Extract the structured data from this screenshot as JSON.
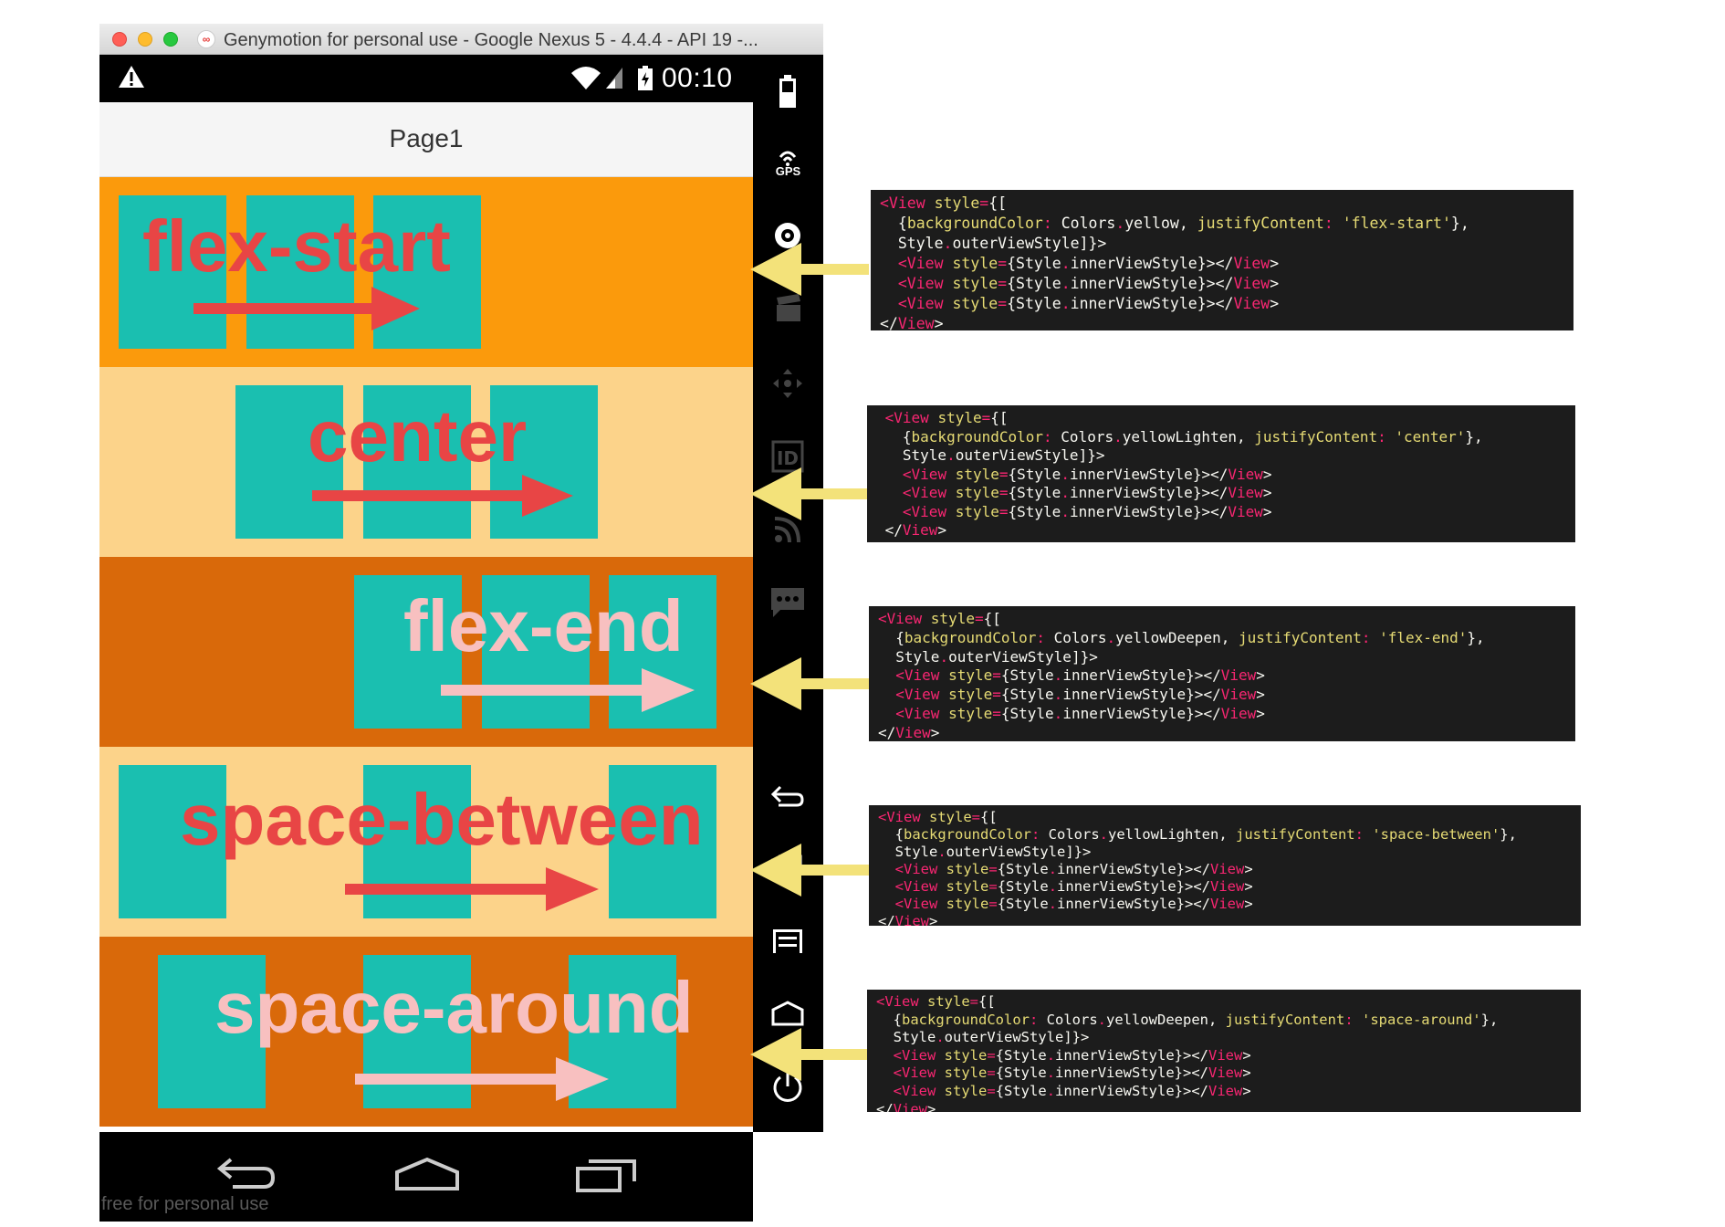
{
  "window": {
    "title": "Genymotion for personal use - Google Nexus 5 - 4.4.4 - API 19 -..."
  },
  "status_bar": {
    "time": "00:10",
    "icons": [
      "warning-icon",
      "wifi-icon",
      "signal-icon",
      "battery-icon"
    ]
  },
  "app_bar": {
    "title": "Page1"
  },
  "rows": [
    {
      "label": "flex-start",
      "bg": "#fb9a0c",
      "label_color": "#e84545"
    },
    {
      "label": "center",
      "bg": "#fcd38a",
      "label_color": "#e84545"
    },
    {
      "label": "flex-end",
      "bg": "#d9690a",
      "label_color": "#f8c0c0"
    },
    {
      "label": "space-between",
      "bg": "#fcd38a",
      "label_color": "#e84545"
    },
    {
      "label": "space-around",
      "bg": "#d9690a",
      "label_color": "#f8c0c0"
    }
  ],
  "colors": {
    "tile": "#1abfb0",
    "pointer_arrow": "#f3e27a",
    "code_bg": "#1c1c1c"
  },
  "toolbar": {
    "gps_label": "GPS",
    "icons": [
      "battery-icon",
      "gps-icon",
      "camera-icon",
      "video-icon",
      "dpad-icon",
      "id-icon",
      "rss-icon",
      "sms-icon",
      "back-icon",
      "recent-apps-icon",
      "menu-icon",
      "home-icon",
      "power-icon",
      "more-icon"
    ]
  },
  "nav_bar": {
    "icons": [
      "back-icon",
      "home-icon",
      "recent-apps-icon"
    ],
    "watermark": "free for personal use"
  },
  "code_snippets": [
    {
      "lines": [
        [
          [
            "t",
            "<View "
          ],
          [
            "a",
            "style"
          ],
          [
            "t",
            "="
          ],
          [
            "p",
            "{["
          ]
        ],
        [
          [
            "p",
            "  {"
          ],
          [
            "a",
            "backgroundColor"
          ],
          [
            "t",
            ": "
          ],
          [
            "p",
            "Colors"
          ],
          [
            "t",
            "."
          ],
          [
            "p",
            "yellow, "
          ],
          [
            "a",
            "justifyContent"
          ],
          [
            "t",
            ": "
          ],
          [
            "s",
            "'flex-start'"
          ],
          [
            "p",
            "},"
          ]
        ],
        [
          [
            "p",
            "  Style"
          ],
          [
            "t",
            "."
          ],
          [
            "p",
            "outerViewStyle]}>"
          ]
        ],
        [
          [
            "p",
            "  "
          ],
          [
            "t",
            "<View "
          ],
          [
            "a",
            "style"
          ],
          [
            "t",
            "="
          ],
          [
            "p",
            "{Style"
          ],
          [
            "t",
            "."
          ],
          [
            "p",
            "innerViewStyle}></"
          ],
          [
            "t",
            "View"
          ],
          [
            "p",
            ">"
          ]
        ],
        [
          [
            "p",
            "  "
          ],
          [
            "t",
            "<View "
          ],
          [
            "a",
            "style"
          ],
          [
            "t",
            "="
          ],
          [
            "p",
            "{Style"
          ],
          [
            "t",
            "."
          ],
          [
            "p",
            "innerViewStyle}></"
          ],
          [
            "t",
            "View"
          ],
          [
            "p",
            ">"
          ]
        ],
        [
          [
            "p",
            "  "
          ],
          [
            "t",
            "<View "
          ],
          [
            "a",
            "style"
          ],
          [
            "t",
            "="
          ],
          [
            "p",
            "{Style"
          ],
          [
            "t",
            "."
          ],
          [
            "p",
            "innerViewStyle}></"
          ],
          [
            "t",
            "View"
          ],
          [
            "p",
            ">"
          ]
        ],
        [
          [
            "p",
            "</"
          ],
          [
            "t",
            "View"
          ],
          [
            "p",
            ">"
          ]
        ]
      ]
    },
    {
      "lines": [
        [
          [
            "p",
            " "
          ],
          [
            "t",
            "<View "
          ],
          [
            "a",
            "style"
          ],
          [
            "t",
            "="
          ],
          [
            "p",
            "{["
          ]
        ],
        [
          [
            "p",
            "   {"
          ],
          [
            "a",
            "backgroundColor"
          ],
          [
            "t",
            ": "
          ],
          [
            "p",
            "Colors"
          ],
          [
            "t",
            "."
          ],
          [
            "p",
            "yellowLighten, "
          ],
          [
            "a",
            "justifyContent"
          ],
          [
            "t",
            ": "
          ],
          [
            "s",
            "'center'"
          ],
          [
            "p",
            "},"
          ]
        ],
        [
          [
            "p",
            "   Style"
          ],
          [
            "t",
            "."
          ],
          [
            "p",
            "outerViewStyle]}>"
          ]
        ],
        [
          [
            "p",
            "   "
          ],
          [
            "t",
            "<View "
          ],
          [
            "a",
            "style"
          ],
          [
            "t",
            "="
          ],
          [
            "p",
            "{Style"
          ],
          [
            "t",
            "."
          ],
          [
            "p",
            "innerViewStyle}></"
          ],
          [
            "t",
            "View"
          ],
          [
            "p",
            ">"
          ]
        ],
        [
          [
            "p",
            "   "
          ],
          [
            "t",
            "<View "
          ],
          [
            "a",
            "style"
          ],
          [
            "t",
            "="
          ],
          [
            "p",
            "{Style"
          ],
          [
            "t",
            "."
          ],
          [
            "p",
            "innerViewStyle}></"
          ],
          [
            "t",
            "View"
          ],
          [
            "p",
            ">"
          ]
        ],
        [
          [
            "p",
            "   "
          ],
          [
            "t",
            "<View "
          ],
          [
            "a",
            "style"
          ],
          [
            "t",
            "="
          ],
          [
            "p",
            "{Style"
          ],
          [
            "t",
            "."
          ],
          [
            "p",
            "innerViewStyle}></"
          ],
          [
            "t",
            "View"
          ],
          [
            "p",
            ">"
          ]
        ],
        [
          [
            "p",
            " </"
          ],
          [
            "t",
            "View"
          ],
          [
            "p",
            ">"
          ]
        ]
      ]
    },
    {
      "lines": [
        [
          [
            "t",
            "<View "
          ],
          [
            "a",
            "style"
          ],
          [
            "t",
            "="
          ],
          [
            "p",
            "{["
          ]
        ],
        [
          [
            "p",
            "  {"
          ],
          [
            "a",
            "backgroundColor"
          ],
          [
            "t",
            ": "
          ],
          [
            "p",
            "Colors"
          ],
          [
            "t",
            "."
          ],
          [
            "p",
            "yellowDeepen, "
          ],
          [
            "a",
            "justifyContent"
          ],
          [
            "t",
            ": "
          ],
          [
            "s",
            "'flex-end'"
          ],
          [
            "p",
            "},"
          ]
        ],
        [
          [
            "p",
            "  Style"
          ],
          [
            "t",
            "."
          ],
          [
            "p",
            "outerViewStyle]}>"
          ]
        ],
        [
          [
            "p",
            "  "
          ],
          [
            "t",
            "<View "
          ],
          [
            "a",
            "style"
          ],
          [
            "t",
            "="
          ],
          [
            "p",
            "{Style"
          ],
          [
            "t",
            "."
          ],
          [
            "p",
            "innerViewStyle}></"
          ],
          [
            "t",
            "View"
          ],
          [
            "p",
            ">"
          ]
        ],
        [
          [
            "p",
            "  "
          ],
          [
            "t",
            "<View "
          ],
          [
            "a",
            "style"
          ],
          [
            "t",
            "="
          ],
          [
            "p",
            "{Style"
          ],
          [
            "t",
            "."
          ],
          [
            "p",
            "innerViewStyle}></"
          ],
          [
            "t",
            "View"
          ],
          [
            "p",
            ">"
          ]
        ],
        [
          [
            "p",
            "  "
          ],
          [
            "t",
            "<View "
          ],
          [
            "a",
            "style"
          ],
          [
            "t",
            "="
          ],
          [
            "p",
            "{Style"
          ],
          [
            "t",
            "."
          ],
          [
            "p",
            "innerViewStyle}></"
          ],
          [
            "t",
            "View"
          ],
          [
            "p",
            ">"
          ]
        ],
        [
          [
            "p",
            "</"
          ],
          [
            "t",
            "View"
          ],
          [
            "p",
            ">"
          ]
        ]
      ]
    },
    {
      "lines": [
        [
          [
            "t",
            "<View "
          ],
          [
            "a",
            "style"
          ],
          [
            "t",
            "="
          ],
          [
            "p",
            "{["
          ]
        ],
        [
          [
            "p",
            "  {"
          ],
          [
            "a",
            "backgroundColor"
          ],
          [
            "t",
            ": "
          ],
          [
            "p",
            "Colors"
          ],
          [
            "t",
            "."
          ],
          [
            "p",
            "yellowLighten, "
          ],
          [
            "a",
            "justifyContent"
          ],
          [
            "t",
            ": "
          ],
          [
            "s",
            "'space-between'"
          ],
          [
            "p",
            "},"
          ]
        ],
        [
          [
            "p",
            "  Style"
          ],
          [
            "t",
            "."
          ],
          [
            "p",
            "outerViewStyle]}>"
          ]
        ],
        [
          [
            "p",
            "  "
          ],
          [
            "t",
            "<View "
          ],
          [
            "a",
            "style"
          ],
          [
            "t",
            "="
          ],
          [
            "p",
            "{Style"
          ],
          [
            "t",
            "."
          ],
          [
            "p",
            "innerViewStyle}></"
          ],
          [
            "t",
            "View"
          ],
          [
            "p",
            ">"
          ]
        ],
        [
          [
            "p",
            "  "
          ],
          [
            "t",
            "<View "
          ],
          [
            "a",
            "style"
          ],
          [
            "t",
            "="
          ],
          [
            "p",
            "{Style"
          ],
          [
            "t",
            "."
          ],
          [
            "p",
            "innerViewStyle}></"
          ],
          [
            "t",
            "View"
          ],
          [
            "p",
            ">"
          ]
        ],
        [
          [
            "p",
            "  "
          ],
          [
            "t",
            "<View "
          ],
          [
            "a",
            "style"
          ],
          [
            "t",
            "="
          ],
          [
            "p",
            "{Style"
          ],
          [
            "t",
            "."
          ],
          [
            "p",
            "innerViewStyle}></"
          ],
          [
            "t",
            "View"
          ],
          [
            "p",
            ">"
          ]
        ],
        [
          [
            "p",
            "</"
          ],
          [
            "t",
            "View"
          ],
          [
            "p",
            ">"
          ]
        ]
      ]
    },
    {
      "lines": [
        [
          [
            "t",
            "<View "
          ],
          [
            "a",
            "style"
          ],
          [
            "t",
            "="
          ],
          [
            "p",
            "{["
          ]
        ],
        [
          [
            "p",
            "  {"
          ],
          [
            "a",
            "backgroundColor"
          ],
          [
            "t",
            ": "
          ],
          [
            "p",
            "Colors"
          ],
          [
            "t",
            "."
          ],
          [
            "p",
            "yellowDeepen, "
          ],
          [
            "a",
            "justifyContent"
          ],
          [
            "t",
            ": "
          ],
          [
            "s",
            "'space-around'"
          ],
          [
            "p",
            "},"
          ]
        ],
        [
          [
            "p",
            "  Style"
          ],
          [
            "t",
            "."
          ],
          [
            "p",
            "outerViewStyle]}>"
          ]
        ],
        [
          [
            "p",
            "  "
          ],
          [
            "t",
            "<View "
          ],
          [
            "a",
            "style"
          ],
          [
            "t",
            "="
          ],
          [
            "p",
            "{Style"
          ],
          [
            "t",
            "."
          ],
          [
            "p",
            "innerViewStyle}></"
          ],
          [
            "t",
            "View"
          ],
          [
            "p",
            ">"
          ]
        ],
        [
          [
            "p",
            "  "
          ],
          [
            "t",
            "<View "
          ],
          [
            "a",
            "style"
          ],
          [
            "t",
            "="
          ],
          [
            "p",
            "{Style"
          ],
          [
            "t",
            "."
          ],
          [
            "p",
            "innerViewStyle}></"
          ],
          [
            "t",
            "View"
          ],
          [
            "p",
            ">"
          ]
        ],
        [
          [
            "p",
            "  "
          ],
          [
            "t",
            "<View "
          ],
          [
            "a",
            "style"
          ],
          [
            "t",
            "="
          ],
          [
            "p",
            "{Style"
          ],
          [
            "t",
            "."
          ],
          [
            "p",
            "innerViewStyle}></"
          ],
          [
            "t",
            "View"
          ],
          [
            "p",
            ">"
          ]
        ],
        [
          [
            "p",
            "</"
          ],
          [
            "t",
            "View"
          ],
          [
            "p",
            ">"
          ]
        ]
      ]
    }
  ]
}
